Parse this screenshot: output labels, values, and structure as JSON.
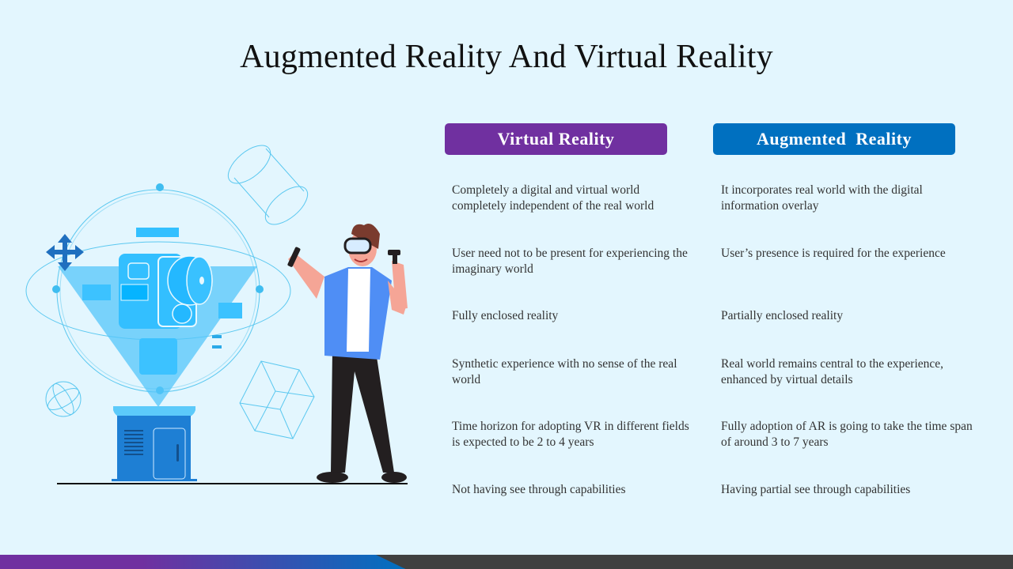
{
  "slide": {
    "title": "Augmented Reality And Virtual Reality"
  },
  "columns": {
    "vr": {
      "header": "Virtual Reality",
      "color": "#7030a0",
      "items": [
        "Completely a digital and virtual world completely independent of the real world",
        "User need not to be present for experiencing the imaginary world",
        "Fully enclosed reality",
        "Synthetic experience with no sense of the real world",
        "Time horizon for adopting VR in different fields is expected to be 2 to 4 years",
        "Not having see through capabilities"
      ]
    },
    "ar": {
      "header": "Augmented  Reality",
      "color": "#0070c0",
      "items": [
        "It incorporates real world with the digital information overlay",
        "User’s presence is required for the experience",
        "Partially enclosed reality",
        "Real world remains central to the experience, enhanced by virtual details",
        "Fully adoption of AR is going to take the time span of around 3 to 7 years",
        "Having partial see through capabilities"
      ]
    }
  },
  "colors": {
    "background": "#e3f6fe",
    "footer_gradient_start": "#7030a0",
    "footer_gradient_end": "#0070c0",
    "footer_dark": "#404040"
  }
}
